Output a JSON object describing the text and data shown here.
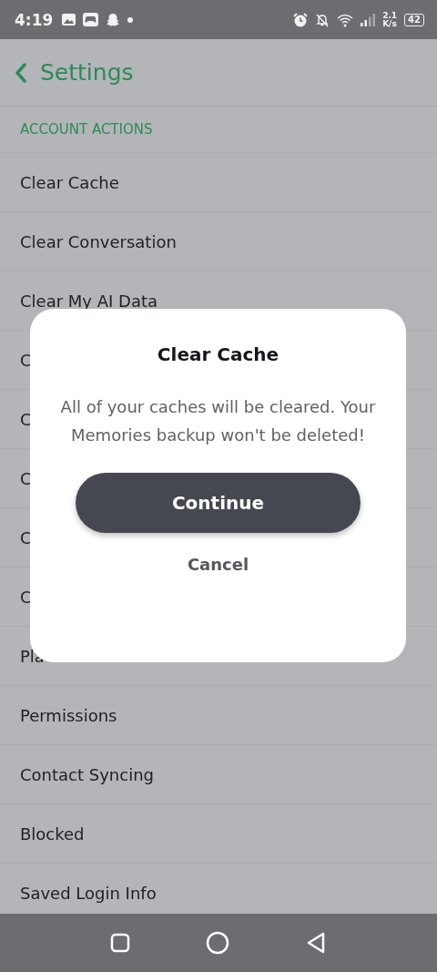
{
  "status_bar": {
    "time": "4:19",
    "speed_value": "2.1",
    "speed_unit": "K/s",
    "battery": "42"
  },
  "header": {
    "title": "Settings"
  },
  "section": {
    "title": "ACCOUNT ACTIONS"
  },
  "items": [
    {
      "label": "Clear Cache"
    },
    {
      "label": "Clear Conversation"
    },
    {
      "label": "Clear My AI Data"
    },
    {
      "label": "C"
    },
    {
      "label": "C"
    },
    {
      "label": "C"
    },
    {
      "label": "C"
    },
    {
      "label": "C"
    },
    {
      "label": "Pla"
    },
    {
      "label": "Permissions"
    },
    {
      "label": "Contact Syncing"
    },
    {
      "label": "Blocked"
    },
    {
      "label": "Saved Login Info"
    }
  ],
  "dialog": {
    "title": "Clear Cache",
    "message": "All of your caches will be cleared. Your Memories backup won't be deleted!",
    "buttons": [
      {
        "label": "Continue",
        "kind": "primary"
      },
      {
        "label": "Cancel",
        "kind": "secondary"
      }
    ]
  }
}
